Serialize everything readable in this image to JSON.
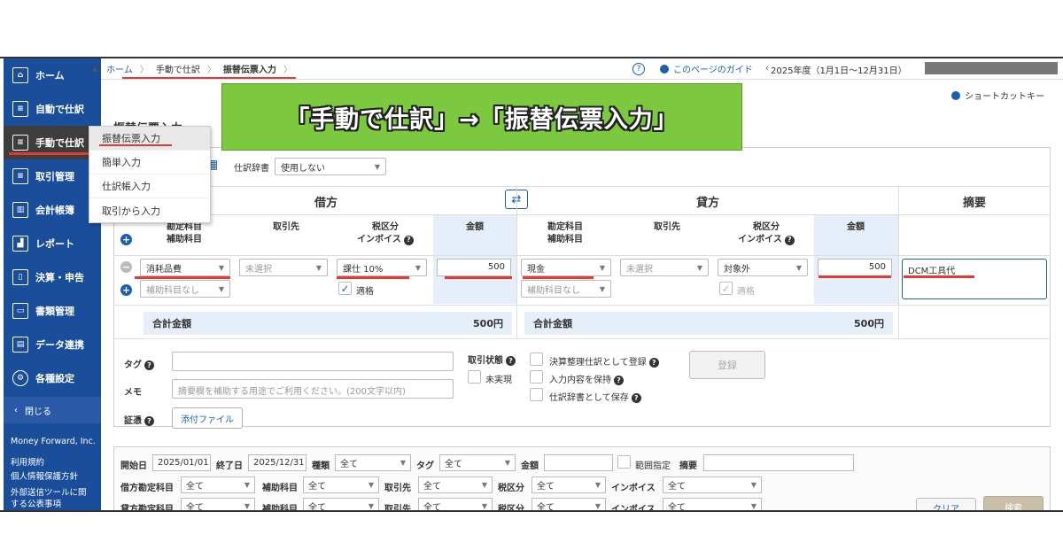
{
  "sidebar": {
    "items": [
      {
        "label": "ホーム",
        "icon": "home-icon"
      },
      {
        "label": "自動で仕訳",
        "icon": "auto-journal-icon"
      },
      {
        "label": "手動で仕訳",
        "icon": "manual-journal-icon"
      },
      {
        "label": "取引管理",
        "icon": "transaction-icon"
      },
      {
        "label": "会計帳簿",
        "icon": "ledger-icon"
      },
      {
        "label": "レポート",
        "icon": "report-icon"
      },
      {
        "label": "決算・申告",
        "icon": "settlement-icon"
      },
      {
        "label": "書類管理",
        "icon": "folder-icon"
      },
      {
        "label": "データ連携",
        "icon": "data-link-icon"
      },
      {
        "label": "各種設定",
        "icon": "gear-icon"
      }
    ],
    "close_label": "閉じる",
    "company": "Money Forward, Inc.",
    "links": [
      "利用規約",
      "個人情報保護方針",
      "外部送信ツールに関",
      "する公表事項"
    ]
  },
  "breadcrumb": [
    "ホーム",
    "手動で仕訳",
    "振替伝票入力"
  ],
  "header": {
    "guide_label": "このページのガイド",
    "fiscal_year": "2025年度（1月1日〜12月31日）",
    "shortcut_label": "ショートカットキー"
  },
  "page_title": "振替伝票入力",
  "menu": {
    "items": [
      "振替伝票入力",
      "簡単入力",
      "仕訳帳入力",
      "取引から入力"
    ]
  },
  "banner": {
    "text": "「手動で仕訳」→「振替伝票入力」"
  },
  "dictionary": {
    "label": "仕訳辞書",
    "value": "使用しない"
  },
  "table": {
    "debit_header": "借方",
    "credit_header": "貸方",
    "memo_header": "摘要",
    "col_account": "勘定科目",
    "col_subaccount": "補助科目",
    "col_partner": "取引先",
    "col_tax": "税区分",
    "col_invoice": "インボイス",
    "col_amount": "金額",
    "debit": {
      "account": "消耗品費",
      "subaccount": "補助科目なし",
      "partner": "未選択",
      "tax": "課仕 10%",
      "invoice_label": "適格",
      "amount": "500"
    },
    "credit": {
      "account": "現金",
      "subaccount": "補助科目なし",
      "partner": "未選択",
      "tax": "対象外",
      "invoice_label": "適格",
      "amount": "500"
    },
    "memo": "DCM工具代",
    "total_label": "合計金額",
    "debit_total": "500円",
    "credit_total": "500円"
  },
  "form": {
    "tag_label": "タグ",
    "memo_label": "メモ",
    "memo_placeholder": "摘要欄を補助する用途でご利用ください。(200文字以内)",
    "evidence_label": "証憑",
    "attach_label": "添付ファイル",
    "status_label": "取引状態",
    "unrealized_label": "未実現",
    "opt_closing": "決算整理仕訳として登録",
    "opt_keep": "入力内容を保持",
    "opt_dict": "仕訳辞書として保存",
    "register_label": "登録"
  },
  "search": {
    "start_label": "開始日",
    "start_value": "2025/01/01",
    "end_label": "終了日",
    "end_value": "2025/12/31",
    "type_label": "種類",
    "tag_label": "タグ",
    "amount_label": "金額",
    "range_label": "範囲指定",
    "memo_label": "摘要",
    "all": "全て",
    "debit_account_label": "借方勘定科目",
    "credit_account_label": "貸方勘定科目",
    "subaccount_label": "補助科目",
    "partner_label": "取引先",
    "tax_label": "税区分",
    "invoice_label": "インボイス",
    "clear_label": "クリア",
    "search_label": "検索"
  }
}
